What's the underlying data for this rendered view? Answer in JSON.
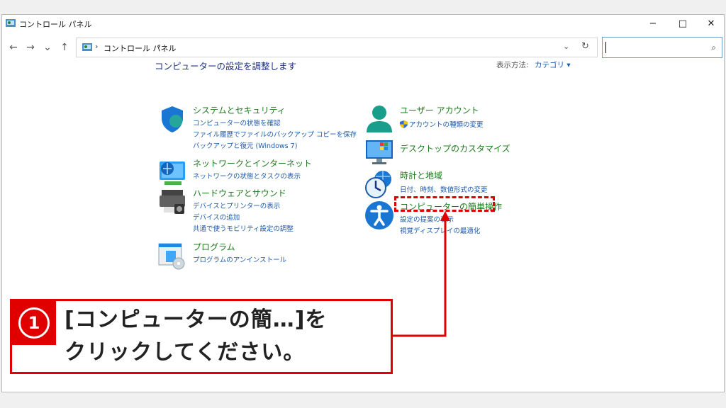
{
  "window": {
    "title": "コントロール パネル",
    "minimize": "−",
    "maximize": "□",
    "close": "✕"
  },
  "nav": {
    "back": "←",
    "forward": "→",
    "recent": "⌄",
    "up": "↑"
  },
  "address": {
    "sep": "›",
    "path": "コントロール パネル",
    "dropdown": "⌄",
    "refresh": "↻"
  },
  "search": {
    "placeholder": "",
    "icon": "⌕"
  },
  "main": {
    "title": "コンピューターの設定を調整します",
    "viewby_label": "表示方法:",
    "viewby_value": "カテゴリ ▾"
  },
  "categories": {
    "system": {
      "title": "システムとセキュリティ",
      "links": [
        "コンピューターの状態を確認",
        "ファイル履歴でファイルのバックアップ コピーを保存",
        "バックアップと復元 (Windows 7)"
      ]
    },
    "network": {
      "title": "ネットワークとインターネット",
      "links": [
        "ネットワークの状態とタスクの表示"
      ]
    },
    "hardware": {
      "title": "ハードウェアとサウンド",
      "links": [
        "デバイスとプリンターの表示",
        "デバイスの追加",
        "共通で使うモビリティ設定の調整"
      ]
    },
    "programs": {
      "title": "プログラム",
      "links": [
        "プログラムのアンインストール"
      ]
    },
    "user": {
      "title": "ユーザー アカウント",
      "links": [
        "アカウントの種類の変更"
      ]
    },
    "appearance": {
      "title": "デスクトップのカスタマイズ",
      "links": []
    },
    "clock": {
      "title": "時計と地域",
      "links": [
        "日付、時刻、数値形式の変更"
      ]
    },
    "ease": {
      "title": "コンピューターの簡単操作",
      "links": [
        "設定の提案の表示",
        "視覚ディスプレイの最適化"
      ]
    }
  },
  "callout": {
    "number": "1",
    "line1": "[コンピューターの簡…]を",
    "line2": "クリックしてください。"
  },
  "colors": {
    "accent_red": "#e00000",
    "link_blue": "#1e5aa8",
    "category_green": "#1c7a1c"
  }
}
